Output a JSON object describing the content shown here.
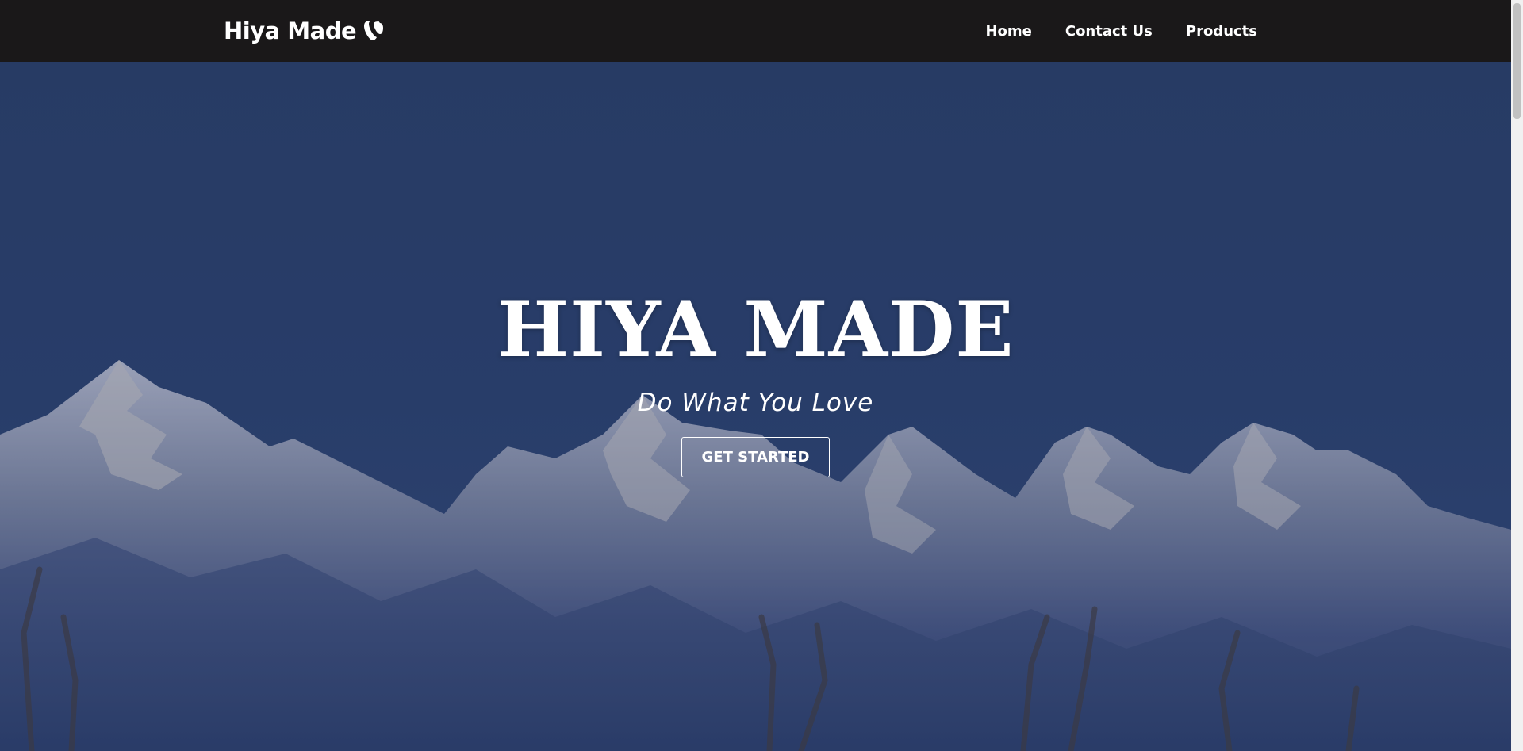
{
  "navbar": {
    "brand": "Hiya Made",
    "brand_icon": "typo3-logo-icon",
    "links": [
      {
        "label": "Home"
      },
      {
        "label": "Contact Us"
      },
      {
        "label": "Products"
      }
    ]
  },
  "hero": {
    "title": "HIYA MADE",
    "subtitle": "Do What You Love",
    "button_label": "GET STARTED",
    "background": "snowy-mountain-range-photo"
  },
  "colors": {
    "navbar_bg": "#1a1819",
    "hero_overlay": "#2b416b",
    "text": "#ffffff"
  }
}
